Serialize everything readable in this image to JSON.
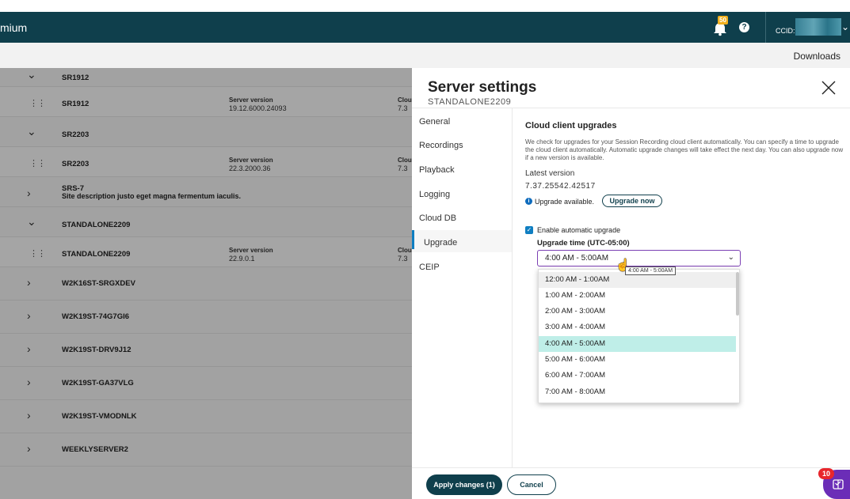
{
  "header": {
    "brand": "mium",
    "notification_count": "50",
    "ccid_label": "CCID:"
  },
  "subbar": {
    "downloads": "Downloads"
  },
  "list": {
    "rows": [
      {
        "type": "group",
        "name": "SR1912"
      },
      {
        "type": "server",
        "name": "SR1912",
        "server_version_label": "Server version",
        "server_version": "19.12.6000.24093",
        "cloud_label": "Clou",
        "cloud_value": "7.3"
      },
      {
        "type": "group",
        "name": "SR2203"
      },
      {
        "type": "server",
        "name": "SR2203",
        "server_version_label": "Server version",
        "server_version": "22.3.2000.36",
        "cloud_label": "Clou",
        "cloud_value": "7.3"
      },
      {
        "type": "collapsed",
        "name": "SRS-7",
        "description": "Site description justo eget magna fermentum iaculis."
      },
      {
        "type": "group",
        "name": "STANDALONE2209"
      },
      {
        "type": "server",
        "name": "STANDALONE2209",
        "server_version_label": "Server version",
        "server_version": "22.9.0.1",
        "cloud_label": "Clou",
        "cloud_value": "7.3"
      },
      {
        "type": "collapsed",
        "name": "W2K16ST-SRGXDEV"
      },
      {
        "type": "collapsed",
        "name": "W2K19ST-74G7GI6"
      },
      {
        "type": "collapsed",
        "name": "W2K19ST-DRV9J12"
      },
      {
        "type": "collapsed",
        "name": "W2K19ST-GA37VLG"
      },
      {
        "type": "collapsed",
        "name": "W2K19ST-VMODNLK"
      },
      {
        "type": "collapsed",
        "name": "WEEKLYSERVER2"
      }
    ]
  },
  "panel": {
    "title": "Server settings",
    "subtitle": "STANDALONE2209",
    "nav": [
      "General",
      "Recordings",
      "Playback",
      "Logging",
      "Cloud DB",
      "Upgrade",
      "CEIP"
    ],
    "active_nav": "Upgrade",
    "section_title": "Cloud client upgrades",
    "section_desc": "We check for upgrades for your Session Recording cloud client automatically. You can specify a time to upgrade the cloud client automatically. Automatic upgrade changes will take effect the next day. You can also upgrade now if a new version is available.",
    "latest_version_label": "Latest version",
    "latest_version": "7.37.25542.42517",
    "upgrade_available": "Upgrade available.",
    "upgrade_now": "Upgrade now",
    "enable_auto_label": "Enable automatic upgrade",
    "enable_auto_checked": true,
    "upgrade_time_label": "Upgrade time (UTC-05:00)",
    "upgrade_time_value": "4:00 AM - 5:00AM",
    "tooltip": "4:00 AM - 5:00AM",
    "options": [
      "12:00 AM - 1:00AM",
      "1:00 AM - 2:00AM",
      "2:00 AM - 3:00AM",
      "3:00 AM - 4:00AM",
      "4:00 AM - 5:00AM",
      "5:00 AM - 6:00AM",
      "6:00 AM - 7:00AM",
      "7:00 AM - 8:00AM"
    ],
    "selected_option": "4:00 AM - 5:00AM",
    "apply_label": "Apply changes (1)",
    "cancel_label": "Cancel"
  },
  "fab": {
    "badge": "10"
  },
  "colors": {
    "header_bg": "#0f3f4c",
    "accent_purple": "#7b3fb3",
    "selected_option_bg": "#bfeee8",
    "hover_option_bg": "#efefef",
    "checkbox_blue": "#0f7ec1",
    "fab_purple": "#6b2db7",
    "badge_red": "#e8262c"
  }
}
